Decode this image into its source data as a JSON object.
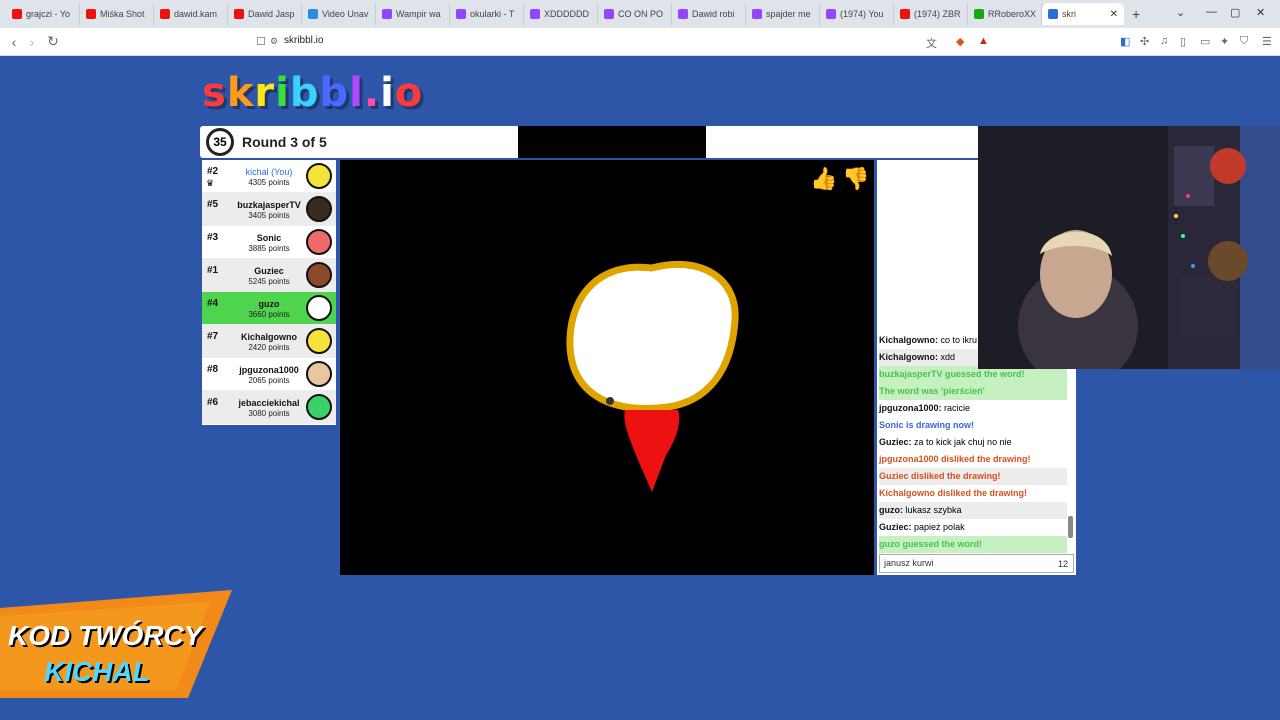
{
  "browser": {
    "tabs": [
      {
        "title": "grajczi - Yo",
        "color": "#e11"
      },
      {
        "title": "Miśka Shot",
        "color": "#e11"
      },
      {
        "title": "dawid.kam",
        "color": "#e11"
      },
      {
        "title": "Dawid Jasp",
        "color": "#e11"
      },
      {
        "title": "Video Unav",
        "color": "#2a8de0"
      },
      {
        "title": "Wampir wa",
        "color": "#9146ff"
      },
      {
        "title": "okularki - T",
        "color": "#9146ff"
      },
      {
        "title": "XDDDDDD",
        "color": "#9146ff"
      },
      {
        "title": "CO ON PO",
        "color": "#9146ff"
      },
      {
        "title": "Dawid robi",
        "color": "#9146ff"
      },
      {
        "title": "spajder me",
        "color": "#9146ff"
      },
      {
        "title": "(1974) You",
        "color": "#9146ff"
      },
      {
        "title": "(1974) ZBR",
        "color": "#e11"
      },
      {
        "title": "RRoberoXX",
        "color": "#1a1"
      }
    ],
    "active_tab": {
      "title": "skri",
      "close": "✕"
    },
    "new_tab": "+",
    "url": "skribbl.io"
  },
  "game": {
    "logo": "skribbl.io",
    "timer": "35",
    "round": "Round 3 of 5",
    "players": [
      {
        "rank": "#2",
        "name": "kichal (You)",
        "points": "4305 points",
        "you": true,
        "guessed": false,
        "avatar": "#f5e23a"
      },
      {
        "rank": "#5",
        "name": "buzkajasperTV",
        "points": "3405 points",
        "you": false,
        "guessed": false,
        "avatar": "#3a2a20"
      },
      {
        "rank": "#3",
        "name": "Sonic",
        "points": "3885 points",
        "you": false,
        "guessed": false,
        "avatar": "#f06a6a"
      },
      {
        "rank": "#1",
        "name": "Guziec",
        "points": "5245 points",
        "you": false,
        "guessed": false,
        "avatar": "#8a4a2a"
      },
      {
        "rank": "#4",
        "name": "guzo",
        "points": "3660 points",
        "you": false,
        "guessed": true,
        "avatar": "#ffffff"
      },
      {
        "rank": "#7",
        "name": "Kichalgowno",
        "points": "2420 points",
        "you": false,
        "guessed": false,
        "avatar": "#f5e23a"
      },
      {
        "rank": "#8",
        "name": "jpguzona1000",
        "points": "2065 points",
        "you": false,
        "guessed": false,
        "avatar": "#e8c6a0"
      },
      {
        "rank": "#6",
        "name": "jebacciekichal",
        "points": "3080 points",
        "you": false,
        "guessed": false,
        "avatar": "#3ad06a"
      }
    ],
    "chat": [
      {
        "user": "Kichalgowno:",
        "text": "co to ikru",
        "style": ""
      },
      {
        "user": "Kichalgowno:",
        "text": "xdd",
        "style": "alt"
      },
      {
        "user": "",
        "text": "buzkajasperTV guessed the word!",
        "style": "green"
      },
      {
        "user": "",
        "text": "The word was 'pierścień'",
        "style": "green"
      },
      {
        "user": "jpguzona1000:",
        "text": "racicie",
        "style": ""
      },
      {
        "user": "",
        "text": "Sonic is drawing now!",
        "style": "blue"
      },
      {
        "user": "Guziec:",
        "text": "za to kick jak chuj no nie",
        "style": ""
      },
      {
        "user": "",
        "text": "jpguzona1000 disliked the drawing!",
        "style": "red"
      },
      {
        "user": "",
        "text": "Guziec disliked the drawing!",
        "style": "red alt"
      },
      {
        "user": "",
        "text": "Kichalgowno disliked the drawing!",
        "style": "red"
      },
      {
        "user": "guzo:",
        "text": "lukasz szybka",
        "style": "alt"
      },
      {
        "user": "Guziec:",
        "text": "papież polak",
        "style": ""
      },
      {
        "user": "",
        "text": "guzo guessed the word!",
        "style": "green"
      }
    ],
    "chat_input_value": "janusz kurwi",
    "char_count": "12"
  },
  "promo": {
    "line1": "KOD TWÓRCY",
    "line2": "KICHAL"
  }
}
